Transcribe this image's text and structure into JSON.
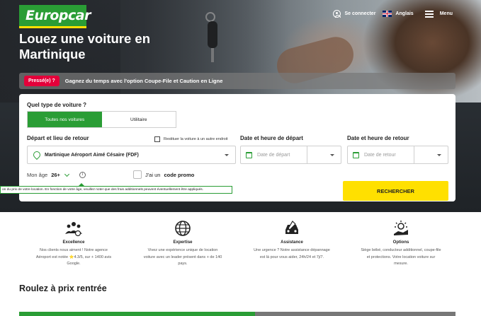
{
  "brand": {
    "logo_text": "Europcar",
    "primary_color": "#2a9d35",
    "accent_color": "#ffe000",
    "badge_color": "#e4003a"
  },
  "nav": {
    "login": {
      "label": "Se connecter",
      "icon": "user-icon"
    },
    "language": {
      "label": "Anglais",
      "icon": "uk-flag-icon"
    },
    "menu": {
      "label": "Menu",
      "icon": "hamburger-icon"
    }
  },
  "hero": {
    "headline_line1": "Louez une voiture en",
    "headline_line2": "Martinique"
  },
  "promo_bar": {
    "badge": "Pressé(e) ?",
    "text": "Gagnez du temps avec l'option Coupe-File et Caution en Ligne"
  },
  "search": {
    "vehicle_type_label": "Quel type de voiture ?",
    "vehicle_types": [
      "Toutes nos voitures",
      "Utilitaire"
    ],
    "vehicle_type_selected": "Toutes nos voitures",
    "pickup_label": "Départ et lieu de retour",
    "return_elsewhere_label": "Restituer la voiture à un autre endroit",
    "location_value": "Martinique Aéroport Aimé Césaire (FDF)",
    "departure_label": "Date et heure de départ",
    "departure_placeholder": "Date de départ",
    "return_label": "Date et heure de retour",
    "return_placeholder": "Date de retour",
    "age_label": "Mon âge",
    "age_value": "26+",
    "promo_code_prefix": "J'ai un",
    "promo_code_label": "code promo",
    "age_tooltip": "on du prix de votre location. En fonction de votre âge, veuillez noter que des frais additionnels peuvent éventuellement être appliqués.",
    "search_button": "RECHERCHER"
  },
  "features": [
    {
      "icon": "team-icon",
      "title": "Excellence",
      "desc": "Nos clients nous aiment ! Notre agence Aéroport est notée ⭐4.3/5, sur + 1400 avis Google."
    },
    {
      "icon": "globe-icon",
      "title": "Expertise",
      "desc": "Vivez une expérience unique de location voiture avec un leader présent dans + de 140 pays."
    },
    {
      "icon": "car-repair-icon",
      "title": "Assistance",
      "desc": "Une urgence ? Notre assistance dépannage est là pour vous aider, 24h/24 et 7j/7."
    },
    {
      "icon": "options-icon",
      "title": "Options",
      "desc": "Siège bébé, conducteur additionnel, coupe-file et protections. Votre location voiture sur mesure."
    }
  ],
  "section": {
    "title": "Roulez à prix rentrée"
  }
}
